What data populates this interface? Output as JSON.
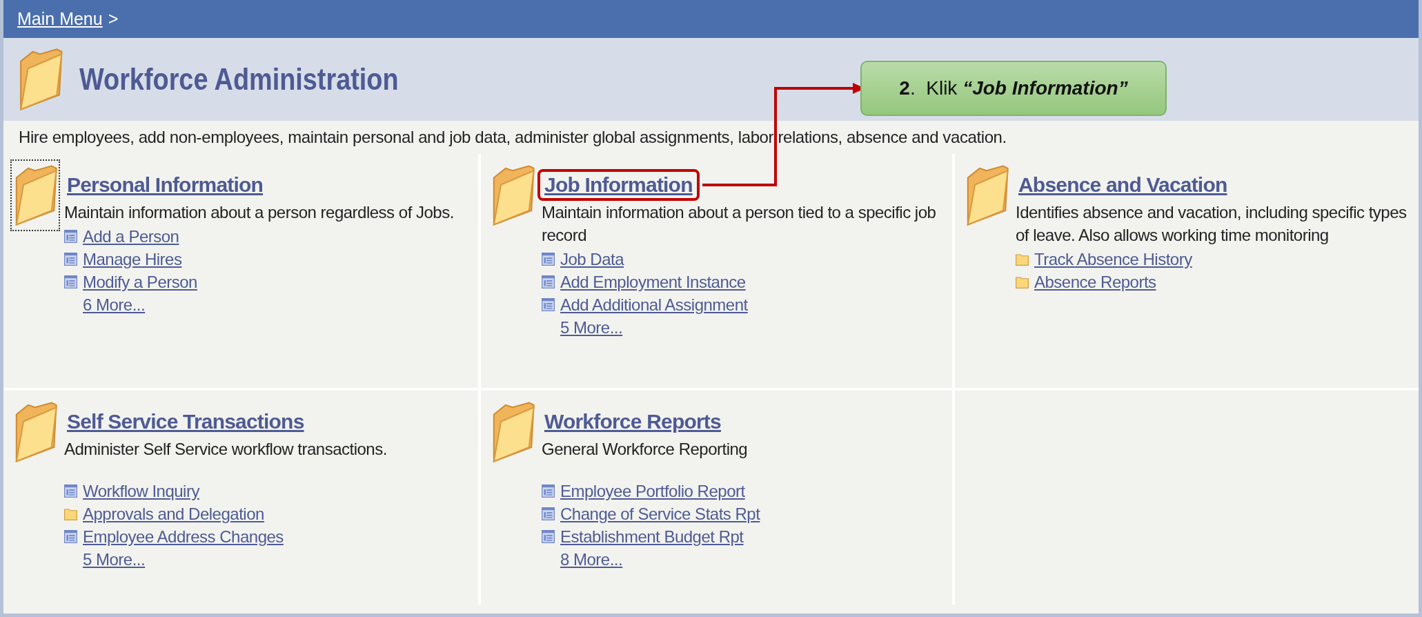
{
  "breadcrumb": {
    "link": "Main Menu",
    "separator": ">"
  },
  "title": "Workforce Administration",
  "description": "Hire employees, add non-employees, maintain personal and job data, administer global assignments, labor relations, absence and vacation.",
  "sections": [
    {
      "title": "Personal Information",
      "focused": true,
      "highlighted": false,
      "description": "Maintain information about a person regardless of Jobs.",
      "items": [
        {
          "kind": "page",
          "label": "Add a Person"
        },
        {
          "kind": "page",
          "label": "Manage Hires"
        },
        {
          "kind": "page",
          "label": "Modify a Person"
        }
      ],
      "more": "6 More..."
    },
    {
      "title": "Job Information",
      "focused": false,
      "highlighted": true,
      "description": "Maintain information about a person tied to a specific job record",
      "items": [
        {
          "kind": "page",
          "label": "Job Data"
        },
        {
          "kind": "page",
          "label": "Add Employment Instance"
        },
        {
          "kind": "page",
          "label": "Add Additional Assignment"
        }
      ],
      "more": "5 More..."
    },
    {
      "title": "Absence and Vacation",
      "focused": false,
      "highlighted": false,
      "description": "Identifies absence and vacation, including specific types of leave. Also allows working time monitoring",
      "items": [
        {
          "kind": "folder",
          "label": "Track Absence History"
        },
        {
          "kind": "folder",
          "label": "Absence Reports"
        }
      ]
    },
    {
      "title": "Self Service Transactions",
      "focused": false,
      "highlighted": false,
      "description": "Administer Self Service workflow transactions.",
      "items": [
        {
          "kind": "page",
          "label": "Workflow Inquiry"
        },
        {
          "kind": "folder",
          "label": "Approvals and Delegation"
        },
        {
          "kind": "page",
          "label": "Employee Address Changes"
        }
      ],
      "more": "5 More..."
    },
    {
      "title": "Workforce Reports",
      "focused": false,
      "highlighted": false,
      "description": "General Workforce Reporting",
      "items": [
        {
          "kind": "page",
          "label": "Employee Portfolio Report"
        },
        {
          "kind": "page",
          "label": "Change of Service Stats Rpt"
        },
        {
          "kind": "page",
          "label": "Establishment Budget Rpt"
        }
      ],
      "more": "8 More..."
    }
  ],
  "callout": {
    "number": "2",
    "separator": ".",
    "verb": "Klik",
    "target": "“Job Information”"
  }
}
